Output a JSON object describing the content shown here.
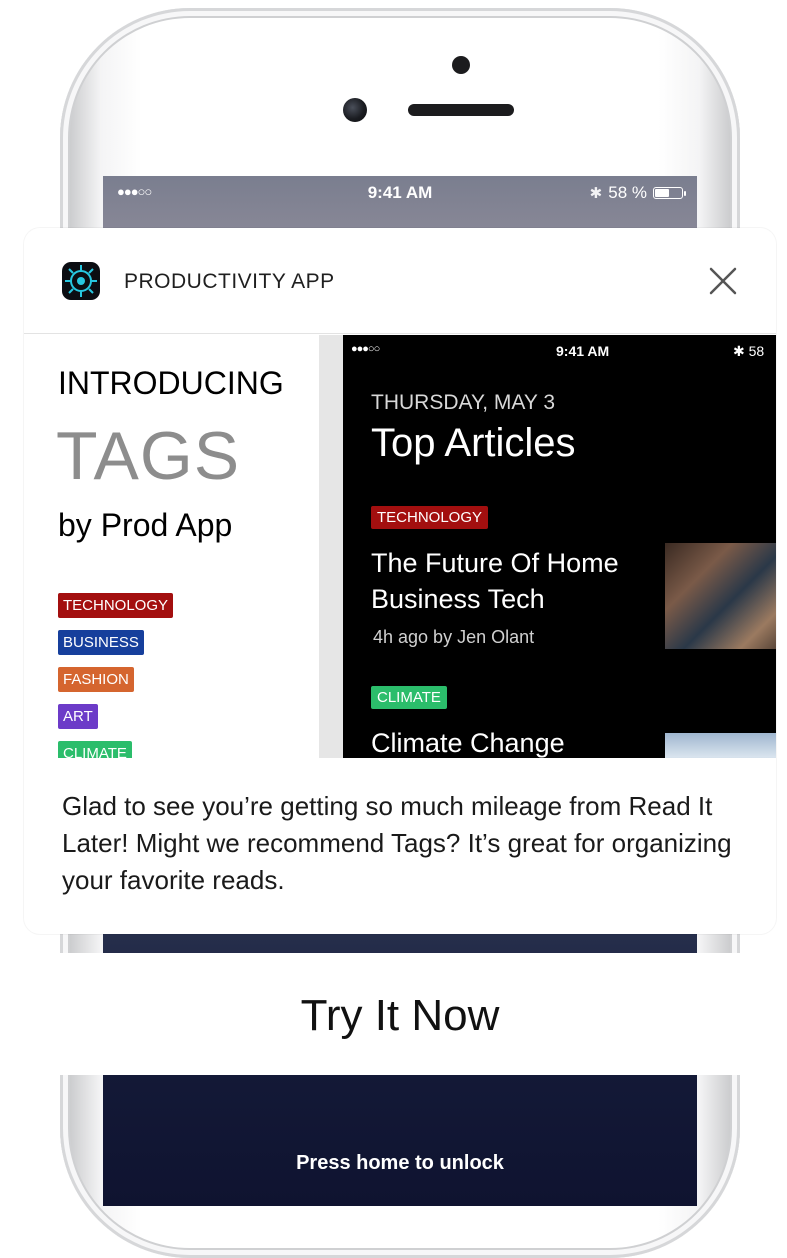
{
  "lock_screen": {
    "status": {
      "signal": "●●●○○",
      "time": "9:41 AM",
      "battery": "58 %",
      "battery_level": 0.58
    },
    "unlock_prompt": "Press home to unlock"
  },
  "notification": {
    "app_name": "PRODUCTIVITY APP",
    "preview": {
      "intro": "INTRODUCING",
      "feature": "TAGS",
      "byline": "by Prod App",
      "tags": [
        {
          "label": "TECHNOLOGY",
          "color": "#a30f0f"
        },
        {
          "label": "BUSINESS",
          "color": "#163f9c"
        },
        {
          "label": "FASHION",
          "color": "#d5652f"
        },
        {
          "label": "ART",
          "color": "#6c3bc8"
        },
        {
          "label": "CLIMATE",
          "color": "#2bbd6b"
        }
      ],
      "phone": {
        "status_signal": "●●●○○",
        "status_time": "9:41 AM",
        "status_battery": "58",
        "date": "THURSDAY, MAY 3",
        "title": "Top Articles",
        "articles": [
          {
            "tag": "TECHNOLOGY",
            "tag_color": "#a30f0f",
            "title": "The Future Of Home Business Tech",
            "meta": "4h ago by Jen Olant"
          },
          {
            "tag": "CLIMATE",
            "tag_color": "#2bbd6b",
            "title": "Climate Change"
          }
        ]
      }
    },
    "message": "Glad to see you’re getting so much mileage from Read It Later! Might we recommend Tags? It’s great for organizing your favorite reads.",
    "action": {
      "label": "Try It Now"
    }
  }
}
